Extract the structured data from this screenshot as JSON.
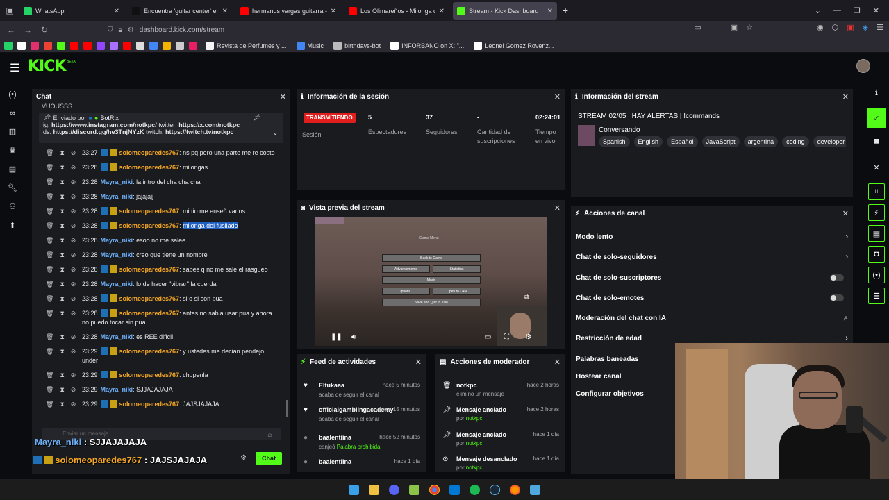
{
  "browser": {
    "tabs": [
      {
        "title": "WhatsApp",
        "color": "#25d366",
        "active": false
      },
      {
        "title": "Encuentra 'guitar center' en TikTok",
        "color": "#111111",
        "active": false
      },
      {
        "title": "hermanos vargas guitarra - YouTube",
        "color": "#ff0000",
        "active": false
      },
      {
        "title": "Los Olimareños - Milonga de",
        "color": "#ff0000",
        "active": false
      },
      {
        "title": "Stream - Kick Dashboard",
        "color": "#53fc18",
        "active": true
      }
    ],
    "new_tab": "+",
    "url": "dashboard.kick.com/stream",
    "bookmarks": [
      {
        "label": "Revista de Perfumes y ...",
        "color": "#f5f5f5"
      },
      {
        "label": "Music",
        "color": "#4285f4"
      },
      {
        "label": "birthdays-bot",
        "color": "#bbbbbb"
      },
      {
        "label": "INFORBANO on X: \"...",
        "color": "#ffffff"
      },
      {
        "label": "Leonel Gomez Rovenz...",
        "color": "#ffffff"
      }
    ],
    "bookmark_icons": [
      "#25d366",
      "#ffffff",
      "#e1306c",
      "#ea4335",
      "#53fc18",
      "#ff0000",
      "#ff0000",
      "#9146ff",
      "#a970ff",
      "#ff0000",
      "#dddddd",
      "#4285f4",
      "#f4b400",
      "#cccccc",
      "#e91e63"
    ]
  },
  "kick": {
    "logo": "KICK",
    "beta": "BETA",
    "left_rail_icons": [
      "broadcast-icon",
      "link-icon",
      "chart-icon",
      "trophy-icon",
      "video-icon",
      "wrench-icon",
      "users-icon",
      "upload-icon"
    ],
    "right_rail_icons": [
      "info-icon",
      "check-icon",
      "layout-icon",
      "close-icon",
      "crop-icon",
      "bolt-icon",
      "document-icon",
      "chat-bubble-icon",
      "broadcast-icon",
      "list-icon"
    ]
  },
  "chat": {
    "title": "Chat",
    "clipped_top": "VUOUSSS",
    "pinned": {
      "sent_by": "Enviado por",
      "bot": "BotRix",
      "line1_prefix": "ig: ",
      "line1_link1": "https://www.instagram.com/notkpc/",
      "line1_mid": " twitter: ",
      "line1_link2": "https://x.com/notkpc",
      "line2_prefix": "ds: ",
      "line2_link1": "https://discord.gg/he3TnjNYzK",
      "line2_mid": " twitch: ",
      "line2_link2": "https://twitch.tv/notkpc"
    },
    "messages": [
      {
        "time": "23:27",
        "user": "solomeoparedes767",
        "type": "sub",
        "text": ": ns pq pero una parte me re costo"
      },
      {
        "time": "23:28",
        "user": "solomeoparedes767",
        "type": "sub",
        "text": ": milongas"
      },
      {
        "time": "23:28",
        "user": "Mayra_niki",
        "type": "plain",
        "text": ": la intro del cha cha cha"
      },
      {
        "time": "23:28",
        "user": "Mayra_niki",
        "type": "plain",
        "text": ": jajajajj"
      },
      {
        "time": "23:28",
        "user": "solomeoparedes767",
        "type": "sub",
        "text": ": mi tio me enseñ varios"
      },
      {
        "time": "23:28",
        "user": "solomeoparedes767",
        "type": "sub",
        "text": ": ",
        "highlight": "milonga del fusilado"
      },
      {
        "time": "23:28",
        "user": "Mayra_niki",
        "type": "plain",
        "text": ": esoo no me salee"
      },
      {
        "time": "23:28",
        "user": "Mayra_niki",
        "type": "plain",
        "text": ": creo que tiene un nombre"
      },
      {
        "time": "23:28",
        "user": "solomeoparedes767",
        "type": "sub",
        "text": ": sabes q no me sale el rasgueo"
      },
      {
        "time": "23:28",
        "user": "Mayra_niki",
        "type": "plain",
        "text": ": lo de hacer \"vibrar\" la cuerda"
      },
      {
        "time": "23:28",
        "user": "solomeoparedes767",
        "type": "sub",
        "text": ": si o si con pua"
      },
      {
        "time": "23:28",
        "user": "solomeoparedes767",
        "type": "sub",
        "text": ": antes no sabia usar pua y ahora no puedo tocar sin pua"
      },
      {
        "time": "23:28",
        "user": "Mayra_niki",
        "type": "plain",
        "text": ": es REE dificil"
      },
      {
        "time": "23:29",
        "user": "solomeoparedes767",
        "type": "sub",
        "text": ": y ustedes me decian pendejo under"
      },
      {
        "time": "23:29",
        "user": "solomeoparedes767",
        "type": "sub",
        "text": ": chupenla"
      },
      {
        "time": "23:29",
        "user": "Mayra_niki",
        "type": "plain",
        "text": ": SJJAJAJAJA"
      },
      {
        "time": "23:29",
        "user": "solomeoparedes767",
        "type": "sub",
        "text": ": JAJSJAJAJA"
      }
    ],
    "input_placeholder": "Enviar un mensaje",
    "send_label": "Chat",
    "overlay": [
      {
        "user": "Mayra_niki",
        "text": " : SJJAJAJAJA"
      },
      {
        "user": "solomeoparedes767",
        "text": " : JAJSJAJAJA"
      }
    ]
  },
  "session": {
    "title": "Información de la sesión",
    "badge": "TRANSMITIENDO",
    "badge_label": "Sesión",
    "stats": [
      {
        "value": "5",
        "label": "Espectadores"
      },
      {
        "value": "37",
        "label": "Seguidores"
      },
      {
        "value": "-",
        "label": "Cantidad de suscripciones"
      },
      {
        "value": "02:24:01",
        "label": "Tiempo en vivo"
      }
    ]
  },
  "stream_info": {
    "title": "Información del stream",
    "stream_title": "STREAM 02/05 | HAY ALERTAS | !commands",
    "category": "Conversando",
    "tags": [
      "Spanish",
      "English",
      "Español",
      "JavaScript",
      "argentina",
      "coding",
      "developer"
    ]
  },
  "preview": {
    "title": "Vista previa del stream",
    "game_menu": {
      "title": "Game Menu",
      "back": "Back to Game",
      "advancements": "Advancements",
      "statistics": "Statistics",
      "mods": "Mods",
      "options": "Options...",
      "lan": "Open to LAN",
      "quit": "Save and Quit to Title"
    }
  },
  "feed": {
    "title": "Feed de actividades",
    "items": [
      {
        "icon": "heart-icon",
        "name": "Eltukaaa",
        "time": "hace 5 minutos",
        "sub": "acaba de seguir el canal",
        "sub_green": ""
      },
      {
        "icon": "heart-icon",
        "name": "officialgamblingacademy",
        "time": "hace 15 minutos",
        "sub": "acaba de seguir el canal",
        "sub_green": ""
      },
      {
        "icon": "avatar-icon",
        "name": "baalentiina",
        "time": "hace 52 minutos",
        "sub": "canjeó ",
        "sub_green": "Palabra prohibida"
      },
      {
        "icon": "avatar-icon",
        "name": "baalentiina",
        "time": "hace 1 día",
        "sub": "",
        "sub_green": ""
      }
    ]
  },
  "mod_actions": {
    "title": "Acciones de moderador",
    "items": [
      {
        "icon": "trash-icon",
        "name": "notkpc",
        "time": "hace 2 horas",
        "sub": "eliminó un mensaje",
        "by": ""
      },
      {
        "icon": "pin-icon",
        "name": "Mensaje anclado",
        "time": "hace 2 horas",
        "sub": "por ",
        "by": "notkpc"
      },
      {
        "icon": "pin-icon",
        "name": "Mensaje anclado",
        "time": "hace 1 día",
        "sub": "por ",
        "by": "notkpc"
      },
      {
        "icon": "unpin-icon",
        "name": "Mensaje desanclado",
        "time": "hace 1 día",
        "sub": "por ",
        "by": "notkpc"
      }
    ]
  },
  "channel_actions": {
    "title": "Acciones de canal",
    "rows": [
      {
        "label": "Modo lento",
        "control": "chevron"
      },
      {
        "label": "Chat de solo-seguidores",
        "control": "chevron"
      },
      {
        "label": "Chat de solo-suscriptores",
        "control": "toggle"
      },
      {
        "label": "Chat de solo-emotes",
        "control": "toggle"
      },
      {
        "label": "Moderación del chat con IA",
        "control": "external"
      },
      {
        "label": "Restricción de edad",
        "control": "chevron"
      },
      {
        "label": "Palabras baneadas",
        "control": "none"
      },
      {
        "label": "Hostear canal",
        "control": "none"
      },
      {
        "label": "Configurar objetivos",
        "control": "none"
      }
    ]
  }
}
